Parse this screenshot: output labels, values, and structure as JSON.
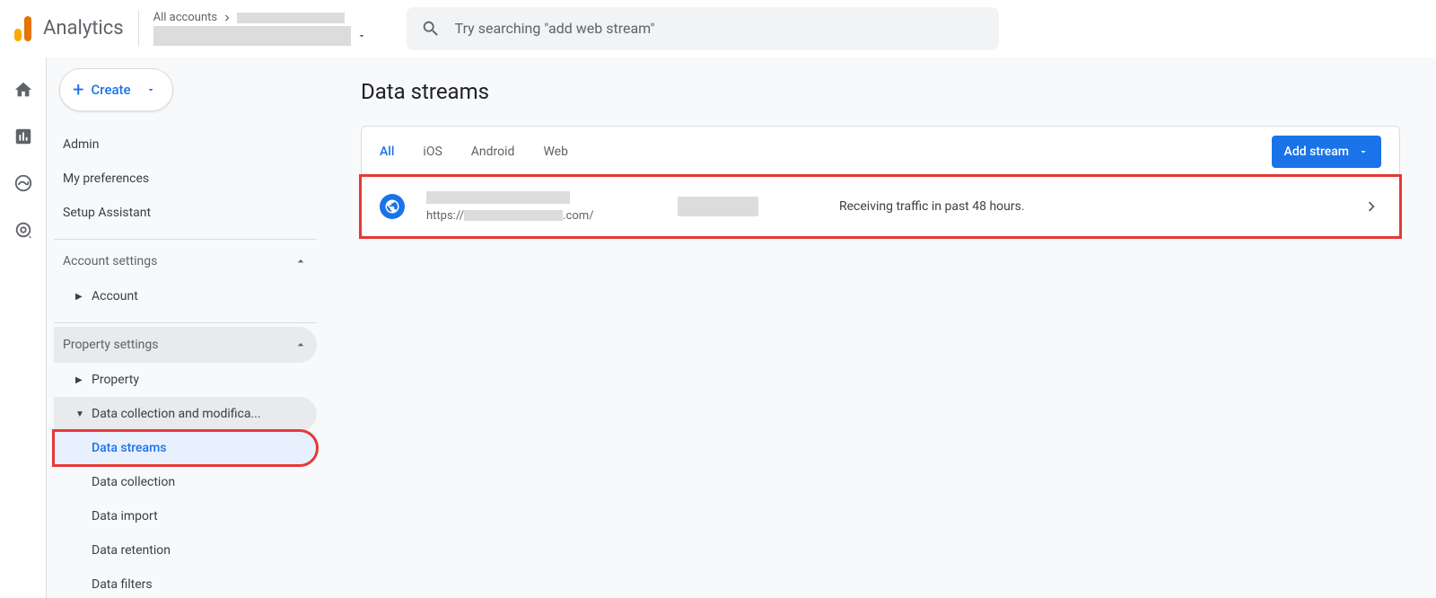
{
  "header": {
    "app_name": "Analytics",
    "account_label": "All accounts",
    "search_placeholder": "Try searching \"add web stream\""
  },
  "sidebar": {
    "create_label": "Create",
    "admin": "Admin",
    "my_preferences": "My preferences",
    "setup_assistant": "Setup Assistant",
    "account_settings": "Account settings",
    "account": "Account",
    "property_settings": "Property settings",
    "property": "Property",
    "data_collection_mod": "Data collection and modifica...",
    "data_streams": "Data streams",
    "data_collection": "Data collection",
    "data_import": "Data import",
    "data_retention": "Data retention",
    "data_filters": "Data filters"
  },
  "main": {
    "title": "Data streams",
    "tabs": {
      "all": "All",
      "ios": "iOS",
      "android": "Android",
      "web": "Web"
    },
    "add_stream": "Add stream",
    "stream": {
      "url_prefix": "https://",
      "url_suffix": ".com/",
      "status": "Receiving traffic in past 48 hours."
    }
  }
}
